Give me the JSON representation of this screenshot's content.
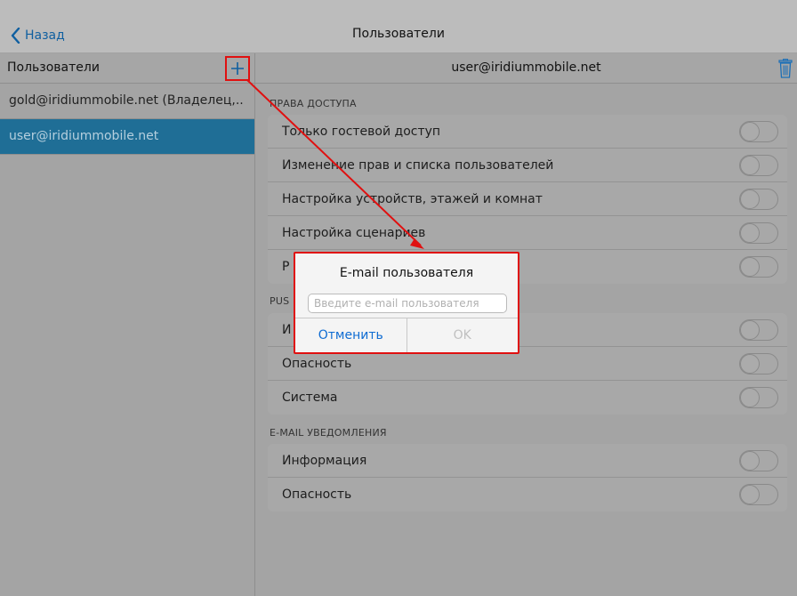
{
  "navbar": {
    "back_label": "Назад",
    "title": "Пользователи"
  },
  "left": {
    "title": "Пользователи",
    "users": [
      {
        "label": "gold@iridiummobile.net (Владелец,...",
        "selected": false
      },
      {
        "label": "user@iridiummobile.net",
        "selected": true
      }
    ]
  },
  "right": {
    "title": "user@iridiummobile.net",
    "sections": [
      {
        "header": "ПРАВА ДОСТУПА",
        "rows": [
          {
            "label": "Только гостевой доступ",
            "on": false
          },
          {
            "label": "Изменение прав и списка пользователей",
            "on": false
          },
          {
            "label": "Настройка устройств, этажей и комнат",
            "on": false
          },
          {
            "label": "Настройка сценариев",
            "on": false
          },
          {
            "label": "Р",
            "on": false
          }
        ]
      },
      {
        "header": "PUS",
        "rows": [
          {
            "label": "И",
            "on": false
          },
          {
            "label": "Опасность",
            "on": false
          },
          {
            "label": "Система",
            "on": false
          }
        ]
      },
      {
        "header": "E-MAIL УВЕДОМЛЕНИЯ",
        "rows": [
          {
            "label": "Информация",
            "on": false
          },
          {
            "label": "Опасность",
            "on": false
          }
        ]
      }
    ]
  },
  "dialog": {
    "title": "E-mail пользователя",
    "input_value": "",
    "input_placeholder": "Введите e-mail пользователя",
    "cancel_label": "Отменить",
    "ok_label": "OK"
  },
  "colors": {
    "accent": "#0f6cd2",
    "selection": "#1f6e96",
    "annotation": "#e01010"
  },
  "icons": {
    "back": "chevron-left-icon",
    "add": "plus-icon",
    "trash": "trash-icon"
  }
}
